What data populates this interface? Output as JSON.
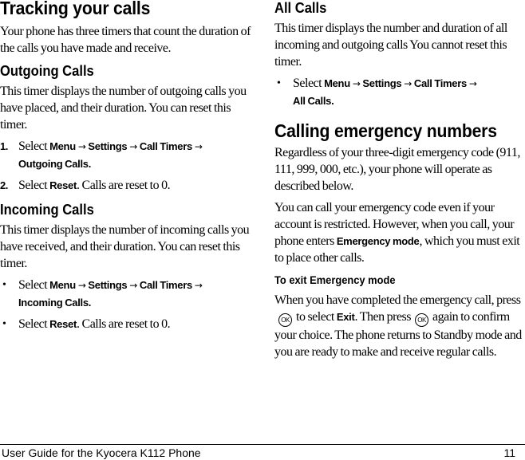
{
  "left": {
    "title": "Tracking your calls",
    "intro": "Your phone has three timers that count the duration of the calls you have made and receive.",
    "outgoing": {
      "heading": "Outgoing Calls",
      "body": "This timer displays the number of outgoing calls you have placed, and their duration. You can reset this timer.",
      "steps": [
        {
          "marker": "1.",
          "prefix": "Select ",
          "path": [
            "Menu",
            "Settings",
            "Call Timers",
            "Outgoing Calls."
          ]
        },
        {
          "marker": "2.",
          "prefix": "Select ",
          "bold": "Reset",
          "suffix": ". Calls are reset to 0."
        }
      ]
    },
    "incoming": {
      "heading": "Incoming Calls",
      "body": "This timer displays the number of incoming calls you have received, and their duration. You can reset this timer.",
      "steps": [
        {
          "marker": "•",
          "prefix": "Select ",
          "path": [
            "Menu",
            "Settings",
            "Call Timers",
            "Incoming Calls."
          ]
        },
        {
          "marker": "•",
          "prefix": "Select ",
          "bold": "Reset",
          "suffix": ". Calls are reset to 0."
        }
      ]
    }
  },
  "right": {
    "all": {
      "heading": "All Calls",
      "body": "This timer displays the number and duration of all incoming and outgoing calls You cannot reset this timer.",
      "steps": [
        {
          "marker": "•",
          "prefix": "Select ",
          "path": [
            "Menu",
            "Settings",
            "Call Timers",
            "All Calls."
          ]
        }
      ]
    },
    "emergency": {
      "title": "Calling emergency numbers",
      "para1": "Regardless of your three-digit emergency code (911, 111, 999, 000, etc.), your phone will operate as described below.",
      "para2_a": "You can call your emergency code even if your account is restricted. However, when you call, your phone enters ",
      "para2_bold": "Emergency mode",
      "para2_b": ", which you must exit to place other calls.",
      "exit_heading": "To exit Emergency mode",
      "exit_a": "When you have completed the emergency call, press",
      "exit_b": "to select ",
      "exit_bold": "Exit",
      "exit_c": ". Then press",
      "exit_d": "again to confirm your choice. The phone returns to Standby mode and you are ready to make and receive regular calls.",
      "ok_icon_label": "OK"
    }
  },
  "arrow": "→",
  "footer": {
    "title": "User Guide for the Kyocera K112 Phone",
    "page": "11"
  }
}
